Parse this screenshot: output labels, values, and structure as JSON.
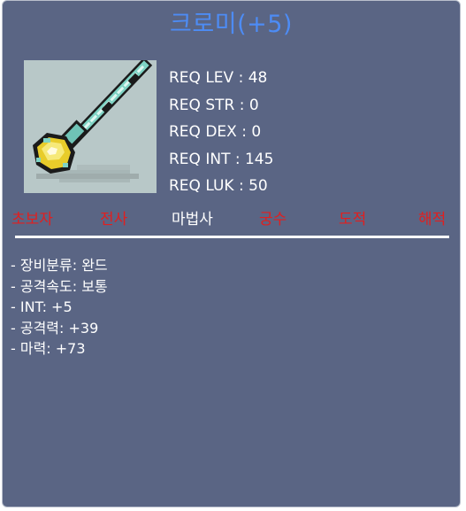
{
  "item": {
    "name": "크로미(+5)"
  },
  "requirements": [
    {
      "label": "REQ LEV : 48"
    },
    {
      "label": "REQ STR : 0"
    },
    {
      "label": "REQ DEX : 0"
    },
    {
      "label": "REQ INT : 145"
    },
    {
      "label": "REQ LUK : 50"
    }
  ],
  "jobs": [
    {
      "label": "초보자",
      "enabled": false
    },
    {
      "label": "전사",
      "enabled": false
    },
    {
      "label": "마법사",
      "enabled": true
    },
    {
      "label": "궁수",
      "enabled": false
    },
    {
      "label": "도적",
      "enabled": false
    },
    {
      "label": "해적",
      "enabled": false
    }
  ],
  "stats": [
    "- 장비분류: 완드",
    "- 공격속도: 보통",
    "- INT: +5",
    "- 공격력: +39",
    "- 마력: +73"
  ],
  "colors": {
    "panel_bg": "#5a6584",
    "title": "#4d8cf5",
    "job_disabled": "#e21e1e",
    "job_enabled": "#ffffff",
    "text": "#ffffff"
  },
  "icons": {
    "item_image": "wand-icon"
  }
}
